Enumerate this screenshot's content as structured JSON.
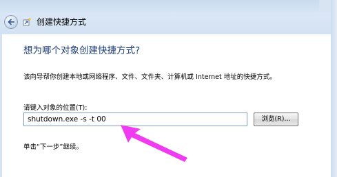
{
  "window": {
    "title": "创建快捷方式"
  },
  "page": {
    "heading": "想为哪个对象创建快捷方式?",
    "description": "该向导帮你创建本地或网络程序、文件、文件夹、计算机或 Internet 地址的快捷方式。",
    "location_label": "请键入对象的位置(T):",
    "location_value": "shutdown.exe -s -t 00",
    "browse_label": "浏览(R)...",
    "hint": "单击“下一步”继续。"
  },
  "icons": {
    "back": "back-arrow-icon",
    "wizard": "shortcut-wizard-icon"
  },
  "colors": {
    "heading": "#1e3f7a",
    "annotation_arrow": "#f03cf0",
    "input_border": "#7a9cc7"
  }
}
